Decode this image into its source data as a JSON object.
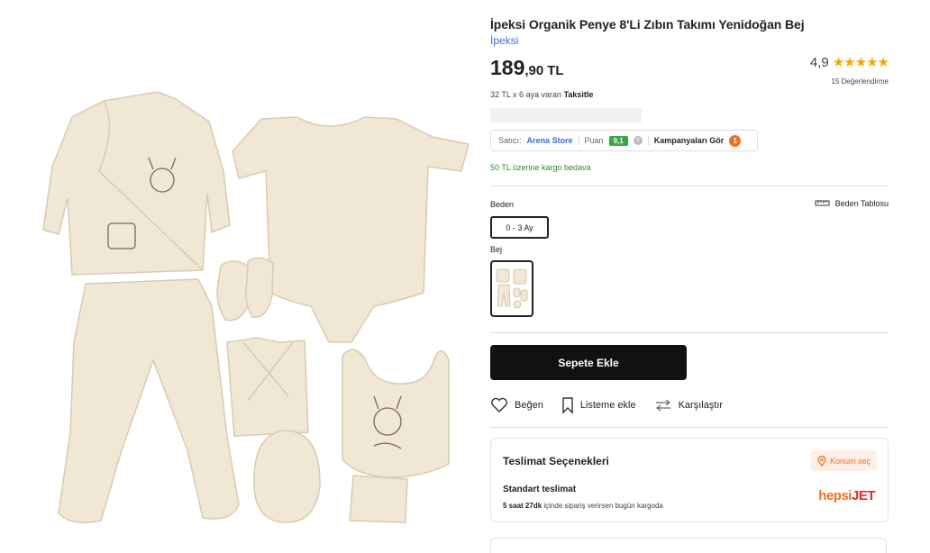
{
  "product": {
    "title": "İpeksi Organik Penye 8'Li Zıbın Takımı Yenidoğan Bej",
    "brand": "İpeksi",
    "price_int": "189",
    "price_dec": ",90",
    "currency": "TL",
    "rating": "4,9",
    "stars": "★★★★★",
    "reviews": "15 Değerlendirme"
  },
  "installment": {
    "prefix": "32 TL x 6 aya varan ",
    "bold": "Taksitle"
  },
  "seller": {
    "label": "Satıcı:",
    "name": "Arena Store",
    "puan_label": "Puan",
    "score": "9,1",
    "q": "?",
    "campaign_label": "Kampanyaları Gör",
    "campaign_count": "1"
  },
  "shipping_note": "50 TL üzerine kargo bedava",
  "size": {
    "label": "Beden",
    "table_label": "Beden Tablosu",
    "option": "0 - 3 Ay"
  },
  "color": {
    "label": "Bej"
  },
  "add_to_cart": "Sepete Ekle",
  "actions": {
    "like": "Beğen",
    "list": "Listeme ekle",
    "compare": "Karşılaştır"
  },
  "delivery": {
    "title": "Teslimat Seçenekleri",
    "location_btn": "Konum seç",
    "standard_title": "Standart teslimat",
    "standard_bold": "5 saat 27dk",
    "standard_rest": " içinde sipariş verirsen bugün kargoda",
    "logo_a": "hepsi",
    "logo_b": "JET"
  },
  "colors": {
    "accent": "#f06f1f",
    "link": "#3b6fc9",
    "score": "#3aa745",
    "green_text": "#2d8a2d",
    "fabric": "#f1e7d5"
  },
  "icons": [
    "star-icon",
    "help-icon",
    "ruler-icon",
    "heart-icon",
    "bookmark-icon",
    "compare-icon",
    "location-pin-icon"
  ]
}
